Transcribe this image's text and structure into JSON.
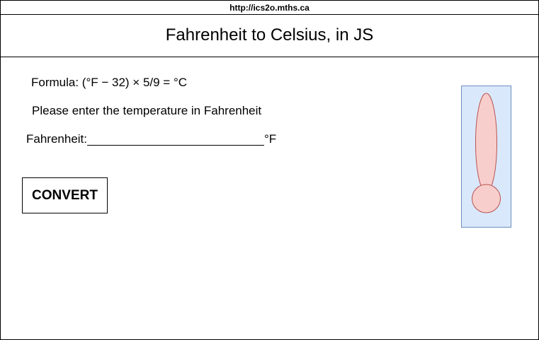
{
  "url_bar": {
    "text": "http://ics2o.mths.ca"
  },
  "header": {
    "title": "Fahrenheit to Celsius, in JS"
  },
  "main": {
    "formula": "Formula: (°F − 32) × 5/9 = °C",
    "prompt": "Please enter the temperature in Fahrenheit",
    "fahrenheit_label": "Fahrenheit:",
    "fahrenheit_value": "",
    "unit_label": "°F",
    "convert_label": "CONVERT"
  },
  "thermometer": {
    "icon": "thermometer-icon",
    "panel_color": "#dae8fc",
    "panel_border_color": "#6c8ebf",
    "bulb_color": "#f8cecc",
    "bulb_border_color": "#b85450"
  }
}
